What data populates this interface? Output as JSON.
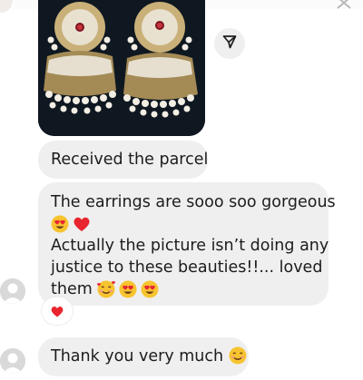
{
  "messages": {
    "received_parcel": "Received the parcel",
    "gorgeous_line1": "The earrings are sooo soo gorgeous",
    "gorgeous_line3": "Actually the picture isn’t doing any",
    "gorgeous_line4": "justice to these beauties!!... loved",
    "gorgeous_line5": "them",
    "thanks": "Thank you very much"
  },
  "icons": {
    "share": "send-icon",
    "close": "close-icon",
    "reaction": "heart-icon",
    "avatar": "avatar-icon"
  },
  "colors": {
    "bubble": "#efefef",
    "heart": "#e8252f",
    "emoji_face": "#f7c430",
    "avatar_placeholder": "#d9d9d9"
  },
  "reaction": {
    "emoji": "heart"
  }
}
